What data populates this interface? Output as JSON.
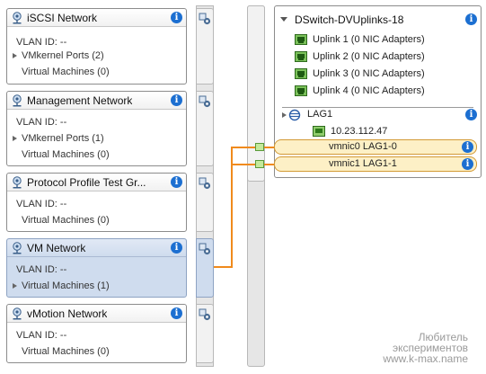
{
  "colors": {
    "wire": "#f08a1c",
    "selected": "#cfdcee",
    "info": "#1c6fd1",
    "uplink_port": "#fdf0c6"
  },
  "port_groups": [
    {
      "title": "iSCSI Network",
      "vlan": "VLAN ID: --",
      "vmkernel": "VMkernel Ports (2)",
      "vms": "Virtual Machines (0)"
    },
    {
      "title": "Management Network",
      "vlan": "VLAN ID: --",
      "vmkernel": "VMkernel Ports (1)",
      "vms": "Virtual Machines (0)"
    },
    {
      "title": "Protocol Profile Test Gr...",
      "vlan": "VLAN ID: --",
      "vms": "Virtual Machines (0)"
    },
    {
      "title": "VM Network",
      "vlan": "VLAN ID: --",
      "vms": "Virtual Machines (1)"
    },
    {
      "title": "vMotion Network",
      "vlan": "VLAN ID: --",
      "vms": "Virtual Machines (0)"
    }
  ],
  "uplink_group": {
    "title": "DSwitch-DVUplinks-18",
    "uplinks": [
      "Uplink 1 (0 NIC Adapters)",
      "Uplink 2 (0 NIC Adapters)",
      "Uplink 3 (0 NIC Adapters)",
      "Uplink 4 (0 NIC Adapters)"
    ],
    "lag": "LAG1",
    "host": "10.23.112.47",
    "vmnics": [
      "vmnic0 LAG1-0",
      "vmnic1 LAG1-1"
    ]
  },
  "info_glyph": "i",
  "watermark": [
    "Любитель",
    "экспериментов",
    "www.k-max.name"
  ],
  "icons": {
    "portgroup": "network-portgroup-icon",
    "uplink": "nic-adapter-icon",
    "lag": "lag-icon",
    "host": "host-icon"
  }
}
